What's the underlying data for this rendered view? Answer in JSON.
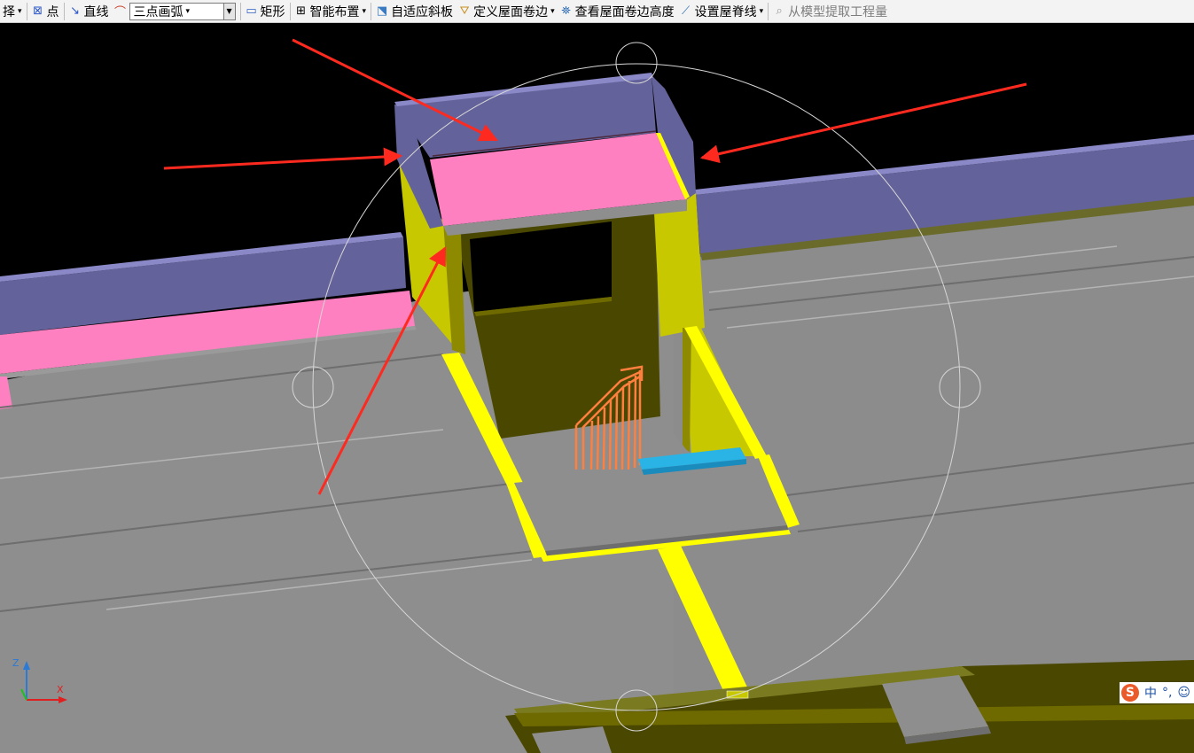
{
  "toolbar": {
    "select_tail": "择",
    "point_label": "点",
    "line_label": "直线",
    "arc_select_value": "三点画弧",
    "rect_label": "矩形",
    "smart_layout_label": "智能布置",
    "adaptive_slab_label": "自适应斜板",
    "define_roll_label": "定义屋面卷边",
    "view_roll_height_label": "查看屋面卷边高度",
    "set_ridge_label": "设置屋脊线",
    "extract_label": "从模型提取工程量"
  },
  "axis": {
    "z": "Z",
    "x": "X"
  },
  "ime": {
    "lang": "中",
    "punct": "°,",
    "emoji": "☺"
  },
  "colors": {
    "toolbar_bg": "#f3f3f3",
    "ground": "#8e8e8e",
    "parapet": "#64629a",
    "roll_pink": "#ff80c0",
    "wall_yellow": "#c8c800",
    "bright_yellow": "#ffff00",
    "stair_orange": "#ff7f3f",
    "step_cyan": "#2ab4e6",
    "arrow_red": "#ff2a1f"
  }
}
